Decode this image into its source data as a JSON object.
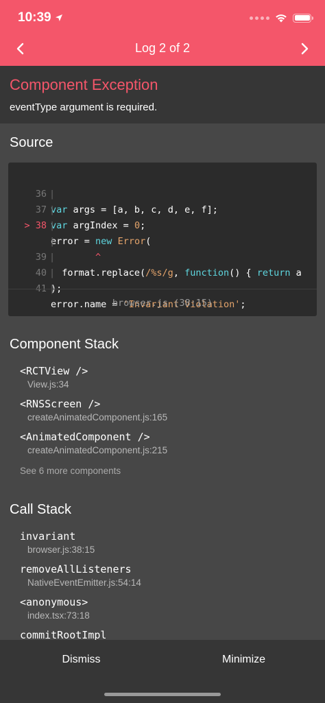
{
  "status_bar": {
    "time": "10:39"
  },
  "header": {
    "title": "Log 2 of 2"
  },
  "exception": {
    "title": "Component Exception",
    "message": "eventType argument is required."
  },
  "source": {
    "title": "Source",
    "lines": [
      {
        "num": "36",
        "text": "var args = [a, b, c, d, e, f];"
      },
      {
        "num": "37",
        "text": "var argIndex = 0;"
      },
      {
        "num": "> 38",
        "text": "error = new Error("
      },
      {
        "num": "",
        "text": "^"
      },
      {
        "num": "39",
        "text": "format.replace(/%s/g, function() { return a"
      },
      {
        "num": "40",
        "text": ");"
      },
      {
        "num": "41",
        "text": "error.name = 'Invariant Violation';"
      }
    ],
    "file": "browser.js (38:15)"
  },
  "component_stack": {
    "title": "Component Stack",
    "items": [
      {
        "name": "<RCTView />",
        "location": "View.js:34"
      },
      {
        "name": "<RNSScreen />",
        "location": "createAnimatedComponent.js:165"
      },
      {
        "name": "<AnimatedComponent />",
        "location": "createAnimatedComponent.js:215"
      }
    ],
    "see_more": "See 6 more components"
  },
  "call_stack": {
    "title": "Call Stack",
    "items": [
      {
        "name": "invariant",
        "location": "browser.js:38:15"
      },
      {
        "name": "removeAllListeners",
        "location": "NativeEventEmitter.js:54:14"
      },
      {
        "name": "<anonymous>",
        "location": "index.tsx:73:18"
      },
      {
        "name": "commitRootImpl",
        "location": ""
      }
    ]
  },
  "footer": {
    "dismiss": "Dismiss",
    "minimize": "Minimize"
  },
  "colors": {
    "accent": "#f4566a",
    "background": "#474747",
    "panel": "#363636",
    "code_bg": "#2b2b2b"
  }
}
